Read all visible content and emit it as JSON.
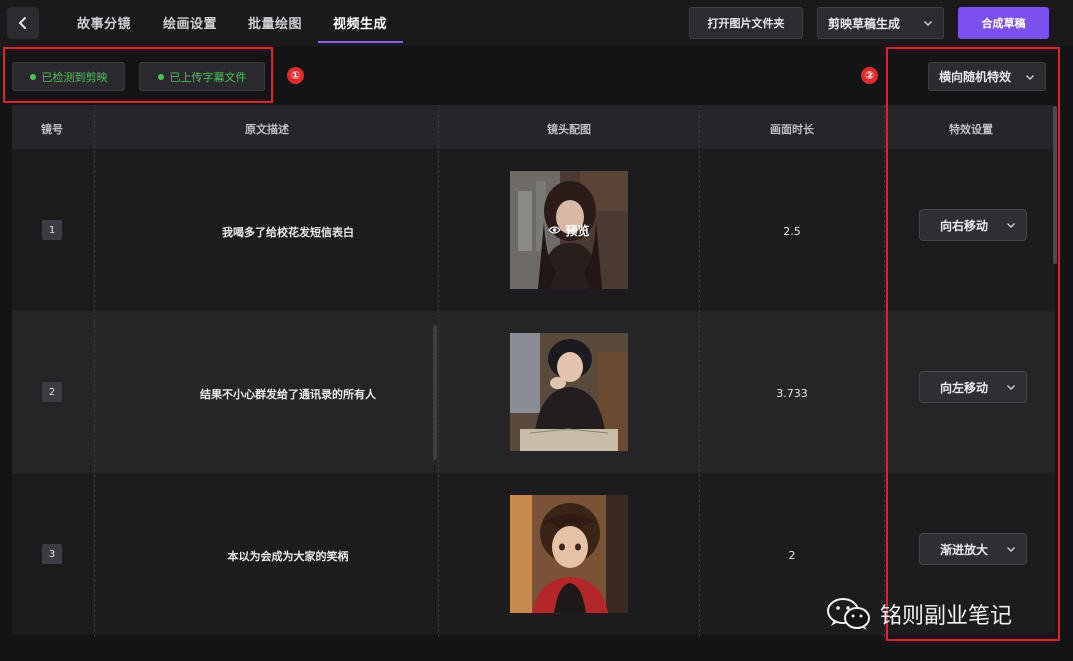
{
  "topbar": {
    "tabs": [
      {
        "label": "故事分镜"
      },
      {
        "label": "绘画设置"
      },
      {
        "label": "批量绘图"
      },
      {
        "label": "视频生成"
      }
    ],
    "open_folder_label": "打开图片文件夹",
    "draft_select_value": "剪映草稿生成",
    "compose_label": "合成草稿"
  },
  "status": {
    "detected_label": "已检测到剪映",
    "uploaded_label": "已上传字幕文件"
  },
  "annotations": {
    "badge1": "①",
    "badge2": "②"
  },
  "global_effect": {
    "value": "横向随机特效"
  },
  "table": {
    "headers": {
      "num": "镜号",
      "desc": "原文描述",
      "image": "镜头配图",
      "duration": "画面时长",
      "effect": "特效设置"
    },
    "preview_label": "预览",
    "rows": [
      {
        "num": "1",
        "desc": "我喝多了给校花发短信表白",
        "duration": "2.5",
        "effect": "向右移动"
      },
      {
        "num": "2",
        "desc": "结果不小心群发给了通讯录的所有人",
        "duration": "3.733",
        "effect": "向左移动"
      },
      {
        "num": "3",
        "desc": "本以为会成为大家的笑柄",
        "duration": "2",
        "effect": "渐进放大"
      }
    ]
  },
  "watermark": {
    "text": "铭则副业笔记"
  },
  "colors": {
    "accent": "#7b4ff0",
    "status_green": "#4cc25a",
    "annotation_red": "#d9262c"
  }
}
